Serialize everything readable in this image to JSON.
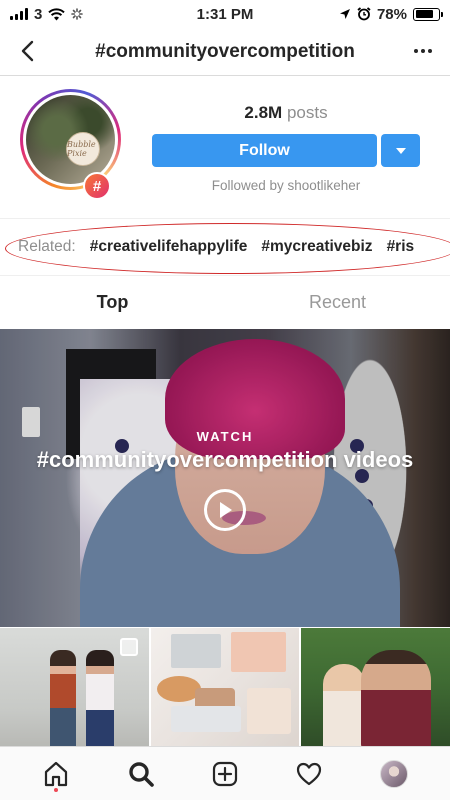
{
  "status_bar": {
    "carrier": "3",
    "time": "1:31 PM",
    "battery": "78%",
    "battery_level": 0.78
  },
  "header": {
    "title": "#communityovercompetition",
    "back_icon": "chevron-left-icon",
    "more_icon": "more-horizontal-icon"
  },
  "hashtag": {
    "posts_count": "2.8M",
    "posts_label": "posts",
    "follow_label": "Follow",
    "followed_by": "Followed by shootlikeher",
    "badge_symbol": "#",
    "avatar_text": "Bubble Pixie"
  },
  "related": {
    "label": "Related:",
    "tags": [
      "#creativelifehappylife",
      "#mycreativebiz",
      "#ris"
    ]
  },
  "tabs": [
    {
      "label": "Top",
      "active": true
    },
    {
      "label": "Recent",
      "active": false
    }
  ],
  "video": {
    "watch_label": "WATCH",
    "title": "#communityovercompetition videos"
  },
  "bottom_nav": [
    {
      "name": "home-icon"
    },
    {
      "name": "search-icon"
    },
    {
      "name": "add-post-icon"
    },
    {
      "name": "heart-icon"
    },
    {
      "name": "profile-avatar"
    }
  ],
  "colors": {
    "accent": "#3897f0",
    "annotation": "#d02a2a",
    "notification": "#ed4956"
  }
}
